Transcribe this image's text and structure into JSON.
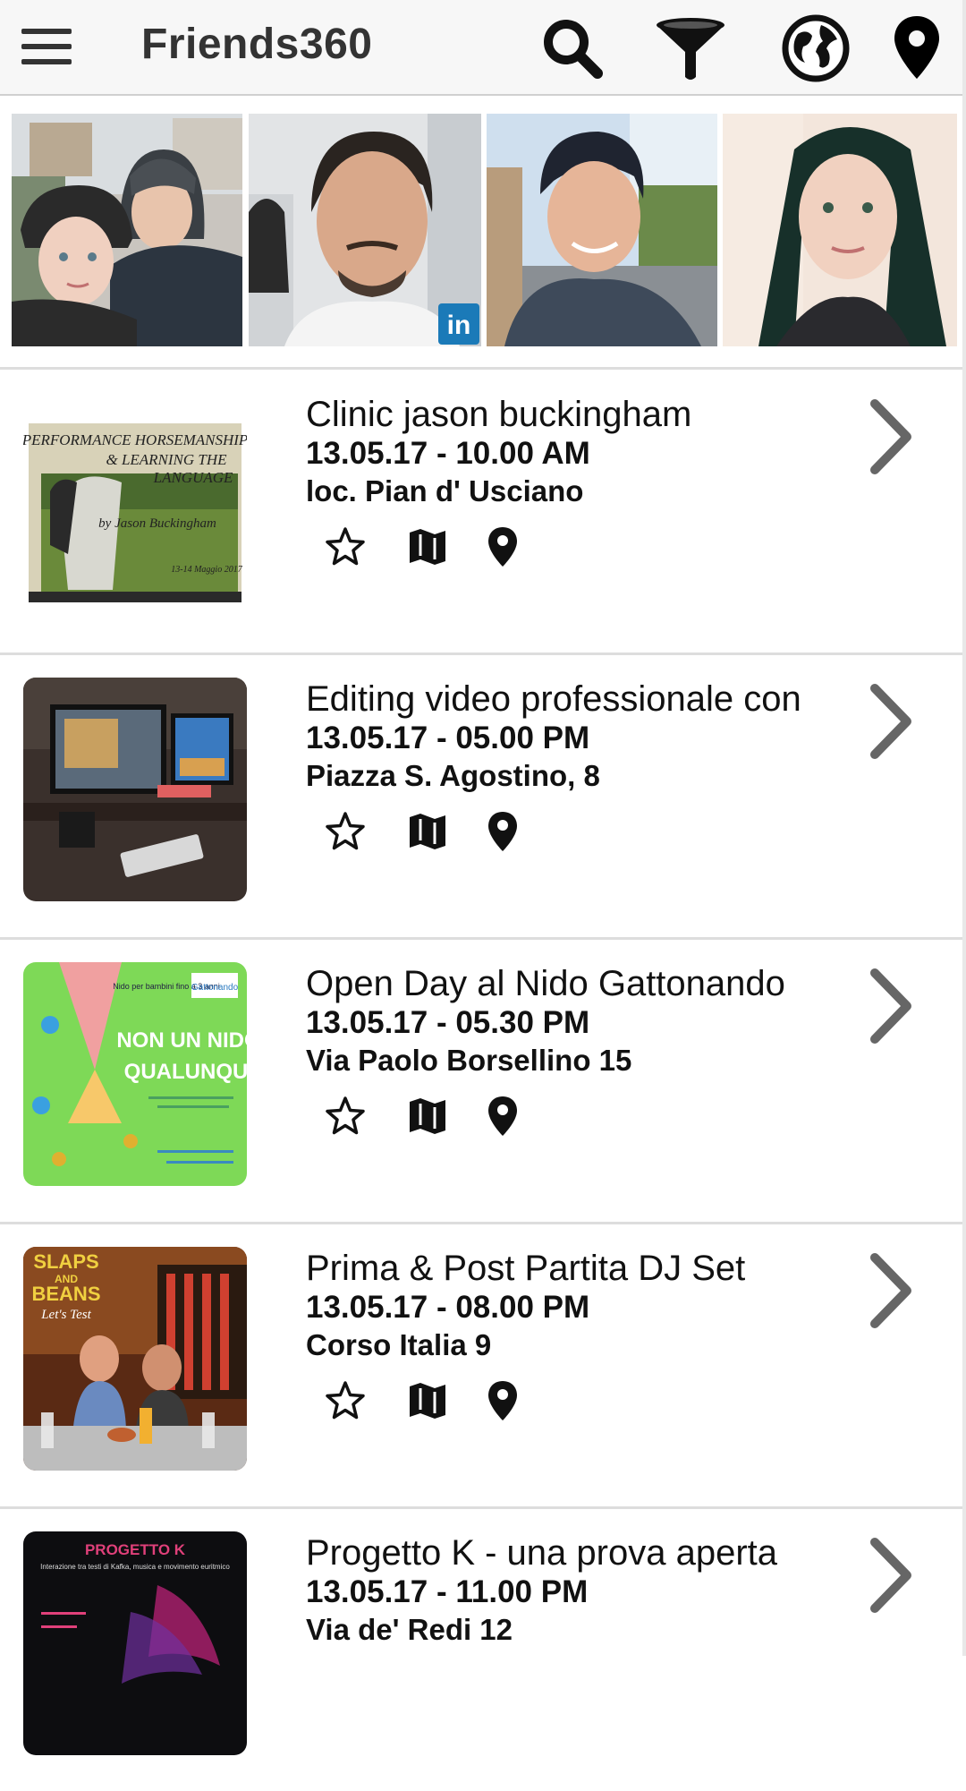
{
  "app": {
    "title": "Friends360"
  },
  "colors": {
    "topbar_bg": "#f7f7f7",
    "icon_dark": "#000000",
    "chevron": "#666666",
    "divider": "#dddddd"
  },
  "toolbar": {
    "icons": [
      "menu-icon",
      "search-icon",
      "filter-icon",
      "globe-icon",
      "location-pin-icon"
    ]
  },
  "friends_strip": {
    "photos": [
      {
        "name": "couple-photo"
      },
      {
        "name": "man-linkedin-photo",
        "badge": "in"
      },
      {
        "name": "man-car-photo"
      },
      {
        "name": "woman-photo"
      }
    ]
  },
  "events": [
    {
      "title": "Clinic jason buckingham",
      "datetime": "13.05.17 - 10.00 AM",
      "location": "loc. Pian d' Usciano",
      "thumb": "horsemanship-poster"
    },
    {
      "title": "Editing video professionale con",
      "datetime": "13.05.17 - 05.00 PM",
      "location": "Piazza S. Agostino, 8",
      "thumb": "computer-desk-photo"
    },
    {
      "title": "Open Day al Nido Gattonando",
      "datetime": "13.05.17 - 05.30 PM",
      "location": "Via Paolo Borsellino 15",
      "thumb": "nursery-poster"
    },
    {
      "title": "Prima & Post Partita DJ Set",
      "datetime": "13.05.17 - 08.00 PM",
      "location": "Corso Italia 9",
      "thumb": "slaps-and-beans-poster"
    },
    {
      "title": "Progetto K - una prova aperta",
      "datetime": "13.05.17 - 11.00 PM",
      "location": "Via de' Redi 12",
      "thumb": "progetto-k-poster"
    }
  ],
  "posters": {
    "horsemanship": {
      "line1": "PERFORMANCE HORSEMANSHIP",
      "line2": "& LEARNING THE",
      "line3": "LANGUAGE",
      "by": "by Jason Buckingham",
      "dates": "13-14 Maggio 2017"
    },
    "nido": {
      "top": "Nido per bambini fino a 3 anni",
      "brand": "Gattonando",
      "line1": "NON UN NIDO",
      "line2": "QUALUNQUE"
    },
    "slaps": {
      "line1": "SLAPS",
      "line2": "AND",
      "line3": "BEANS",
      "sub": "Let's Test"
    },
    "progetto": {
      "title": "PROGETTO K",
      "sub": "Interazione tra testi di Kafka, musica e movimento euritmico"
    }
  }
}
